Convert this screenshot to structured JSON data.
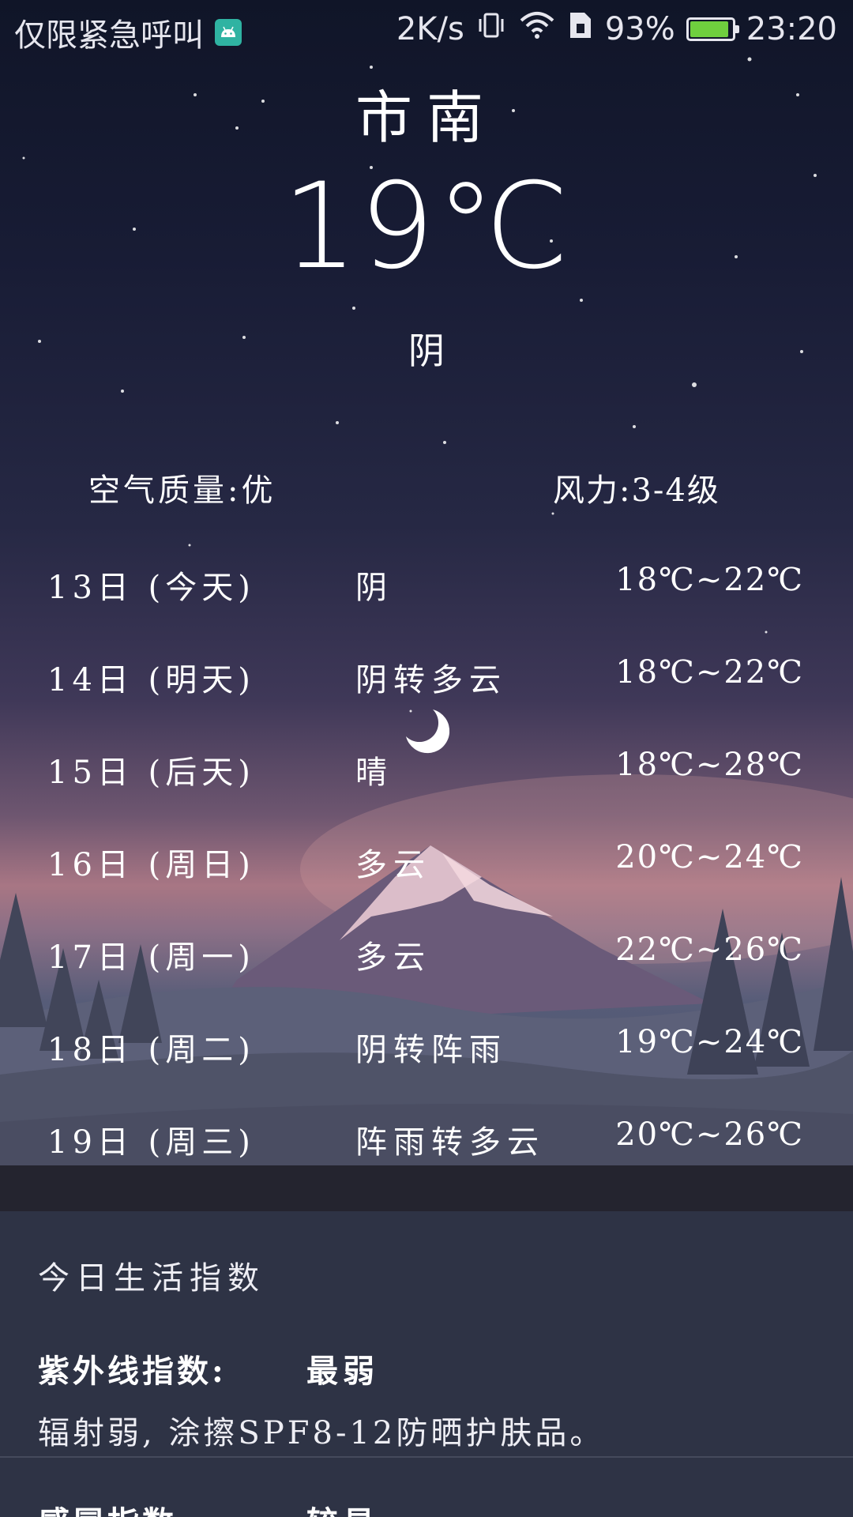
{
  "status_bar": {
    "carrier": "仅限紧急呼叫",
    "net_speed": "2K/s",
    "battery": "93%",
    "battery_level": 0.93,
    "time": "23:20"
  },
  "weather": {
    "city": "市南",
    "temperature": "19℃",
    "condition": "阴",
    "air_quality": "空气质量:优",
    "wind": "风力:3-4级"
  },
  "forecast": [
    {
      "day": "13日 (今天)",
      "condition": "阴",
      "range": "18℃~22℃"
    },
    {
      "day": "14日 (明天)",
      "condition": "阴转多云",
      "range": "18℃~22℃"
    },
    {
      "day": "15日 (后天)",
      "condition": "晴",
      "range": "18℃~28℃"
    },
    {
      "day": "16日 (周日)",
      "condition": "多云",
      "range": "20℃~24℃"
    },
    {
      "day": "17日 (周一)",
      "condition": "多云",
      "range": "22℃~26℃"
    },
    {
      "day": "18日 (周二)",
      "condition": "阴转阵雨",
      "range": "19℃~24℃"
    },
    {
      "day": "19日 (周三)",
      "condition": "阵雨转多云",
      "range": "20℃~26℃"
    }
  ],
  "life_index": {
    "title": "今日生活指数",
    "uv_label": "紫外线指数:",
    "uv_value": "最弱",
    "uv_desc": "辐射弱, 涂擦SPF8-12防晒护肤品。",
    "cold_label": "感冒指数:",
    "cold_value": "较易"
  },
  "icons": {
    "android_notification": "android-icon",
    "vibrate": "vibrate-icon",
    "wifi": "wifi-icon",
    "sim": "sim-icon",
    "battery": "battery-icon"
  },
  "colors": {
    "accent_battery": "#6fcf3e",
    "life_panel": "#2e3345"
  }
}
